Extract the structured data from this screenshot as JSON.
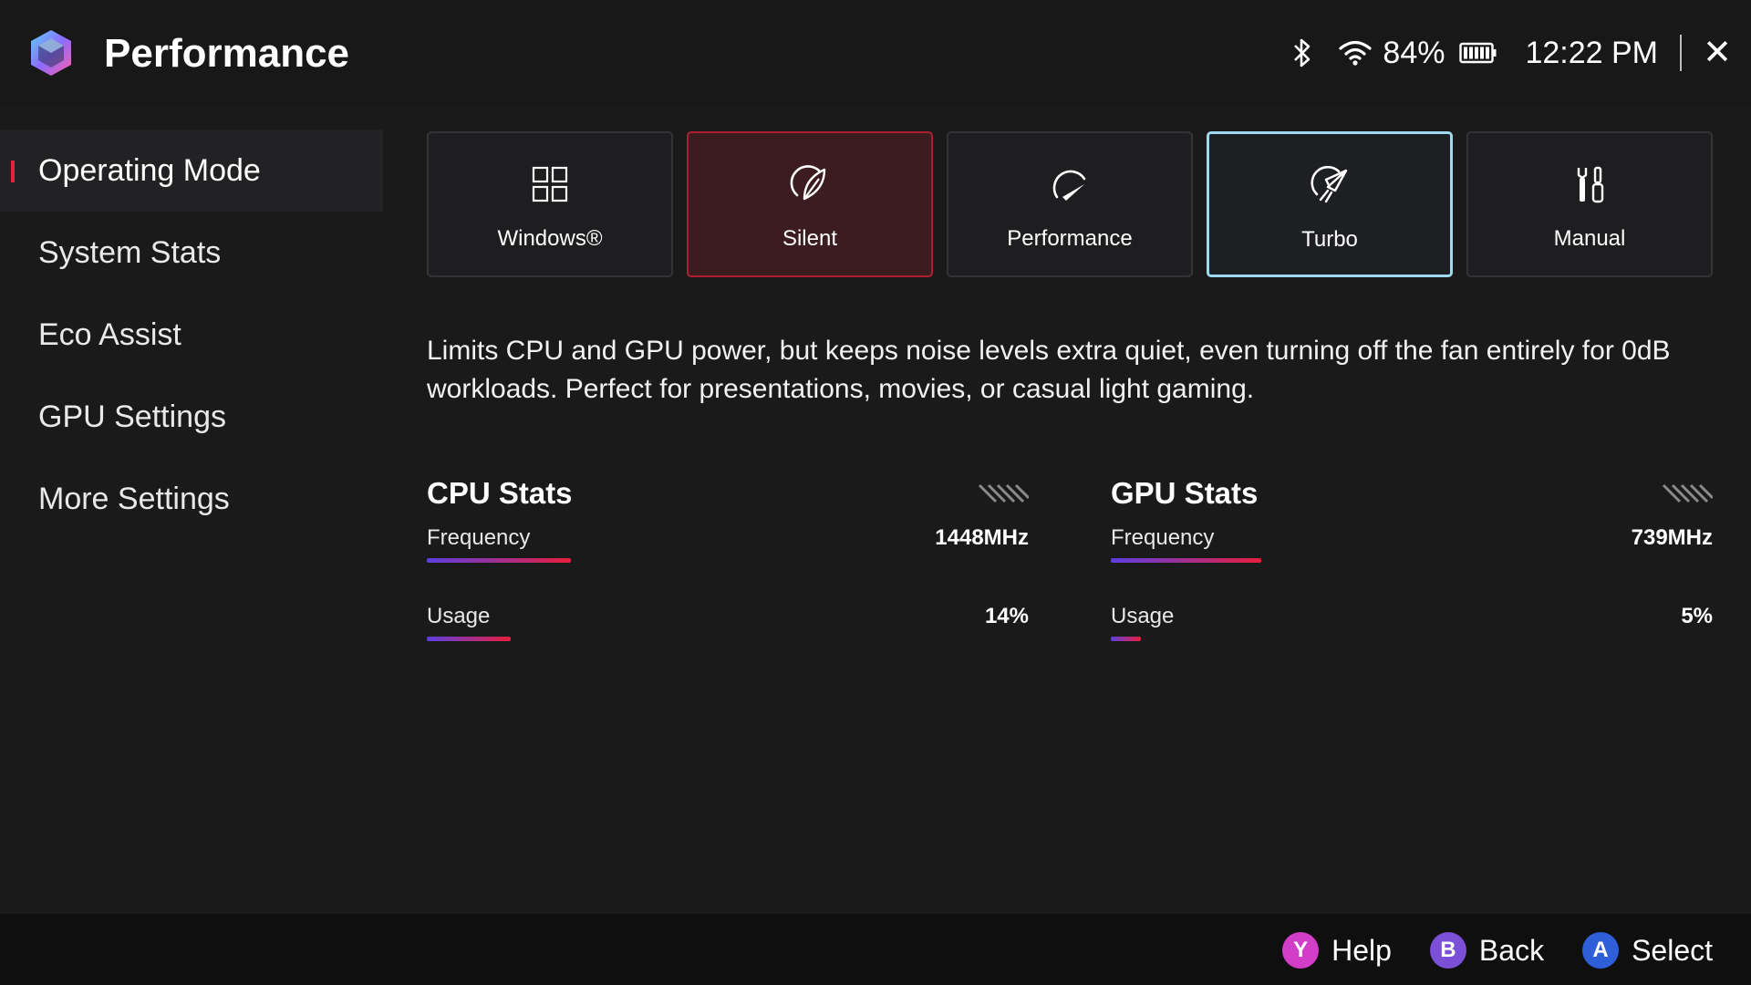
{
  "header": {
    "title": "Performance",
    "logo_icon": "armoury-crate-logo-icon",
    "status": {
      "bluetooth_icon": "bluetooth-icon",
      "wifi_icon": "wifi-icon",
      "battery_percent": "84%",
      "battery_icon": "battery-icon",
      "time": "12:22 PM",
      "close_label": "✕"
    }
  },
  "sidebar": {
    "items": [
      {
        "label": "Operating Mode",
        "active": true
      },
      {
        "label": "System Stats",
        "active": false
      },
      {
        "label": "Eco Assist",
        "active": false
      },
      {
        "label": "GPU Settings",
        "active": false
      },
      {
        "label": "More Settings",
        "active": false
      }
    ]
  },
  "modes": [
    {
      "label": "Windows®",
      "icon": "windows-grid-icon",
      "state": "normal"
    },
    {
      "label": "Silent",
      "icon": "silent-leaf-icon",
      "state": "selected"
    },
    {
      "label": "Performance",
      "icon": "performance-gauge-icon",
      "state": "normal"
    },
    {
      "label": "Turbo",
      "icon": "turbo-rocket-icon",
      "state": "focused"
    },
    {
      "label": "Manual",
      "icon": "manual-tools-icon",
      "state": "normal"
    }
  ],
  "description": "Limits CPU and GPU power, but keeps noise levels extra quiet, even turning off the fan entirely for 0dB workloads. Perfect for presentations, movies, or casual light gaming.",
  "cpu_stats": {
    "title": "CPU Stats",
    "frequency": {
      "label": "Frequency",
      "value": "1448MHz",
      "bar_level": 0.24
    },
    "usage": {
      "label": "Usage",
      "value": "14%",
      "bar_level": 0.14
    }
  },
  "gpu_stats": {
    "title": "GPU Stats",
    "frequency": {
      "label": "Frequency",
      "value": "739MHz",
      "bar_level": 0.25
    },
    "usage": {
      "label": "Usage",
      "value": "5%",
      "bar_level": 0.05
    }
  },
  "footer": {
    "hints": [
      {
        "button": "Y",
        "label": "Help",
        "color": "#d33ec8"
      },
      {
        "button": "B",
        "label": "Back",
        "color": "#7b4fd6"
      },
      {
        "button": "A",
        "label": "Select",
        "color": "#2f5fd8"
      }
    ]
  },
  "colors": {
    "accent_red": "#e8213a",
    "selected_tile_bg": "#3c1c21",
    "focus_outline": "#9ed9ef",
    "bar_start": "#5b3fe0",
    "bar_end": "#e81e3d"
  }
}
